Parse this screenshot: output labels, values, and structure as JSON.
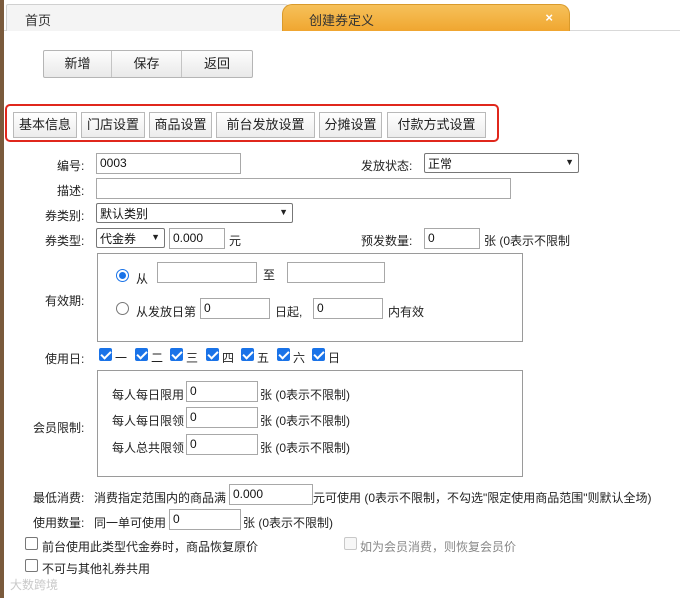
{
  "tabs": {
    "home": "首页",
    "active": "创建券定义",
    "close": "×"
  },
  "toolbar": {
    "add": "新增",
    "save": "保存",
    "back": "返回"
  },
  "sections": [
    "基本信息",
    "门店设置",
    "商品设置",
    "前台发放设置",
    "分摊设置",
    "付款方式设置"
  ],
  "form": {
    "code_label": "编号:",
    "code_value": "0003",
    "issue_status_label": "发放状态:",
    "issue_status_value": "正常",
    "desc_label": "描述:",
    "desc_value": "",
    "category_label": "券类别:",
    "category_value": "默认类别",
    "type_label": "券类型:",
    "type_value": "代金券",
    "amount_value": "0.000",
    "amount_unit": "元",
    "preissue_label": "预发数量:",
    "preissue_value": "0",
    "preissue_unit": "张 (0表示不限制",
    "validity_label": "有效期:",
    "from_label": "从",
    "to_label": "至",
    "from_value": "",
    "to_value": "",
    "from_issue_label": "从发放日第",
    "from_issue_day": "0",
    "day_start_label": "日起,",
    "valid_days_value": "0",
    "valid_within_label": "内有效",
    "useday_label": "使用日:",
    "weekdays": [
      "一",
      "二",
      "三",
      "四",
      "五",
      "六",
      "日"
    ],
    "member_limit_label": "会员限制:",
    "member_limits": [
      {
        "label": "每人每日限用",
        "value": "0",
        "unit": "张 (0表示不限制)"
      },
      {
        "label": "每人每日限领",
        "value": "0",
        "unit": "张 (0表示不限制)"
      },
      {
        "label": "每人总共限领",
        "value": "0",
        "unit": "张 (0表示不限制)"
      }
    ],
    "min_spend_label": "最低消费:",
    "min_spend_prefix": "消费指定范围内的商品满",
    "min_spend_value": "0.000",
    "min_spend_suffix": "元可使用 (0表示不限制，不勾选\"限定使用商品范围\"则默认全场)",
    "use_qty_label": "使用数量:",
    "use_qty_prefix": "同一单可使用",
    "use_qty_value": "0",
    "use_qty_unit": "张 (0表示不限制)",
    "restore_price_label": "前台使用此类型代金券时，商品恢复原价",
    "member_price_label": "如为会员消费，则恢复会员价",
    "no_combine_label": "不可与其他礼券共用"
  },
  "watermark": "大数跨境"
}
